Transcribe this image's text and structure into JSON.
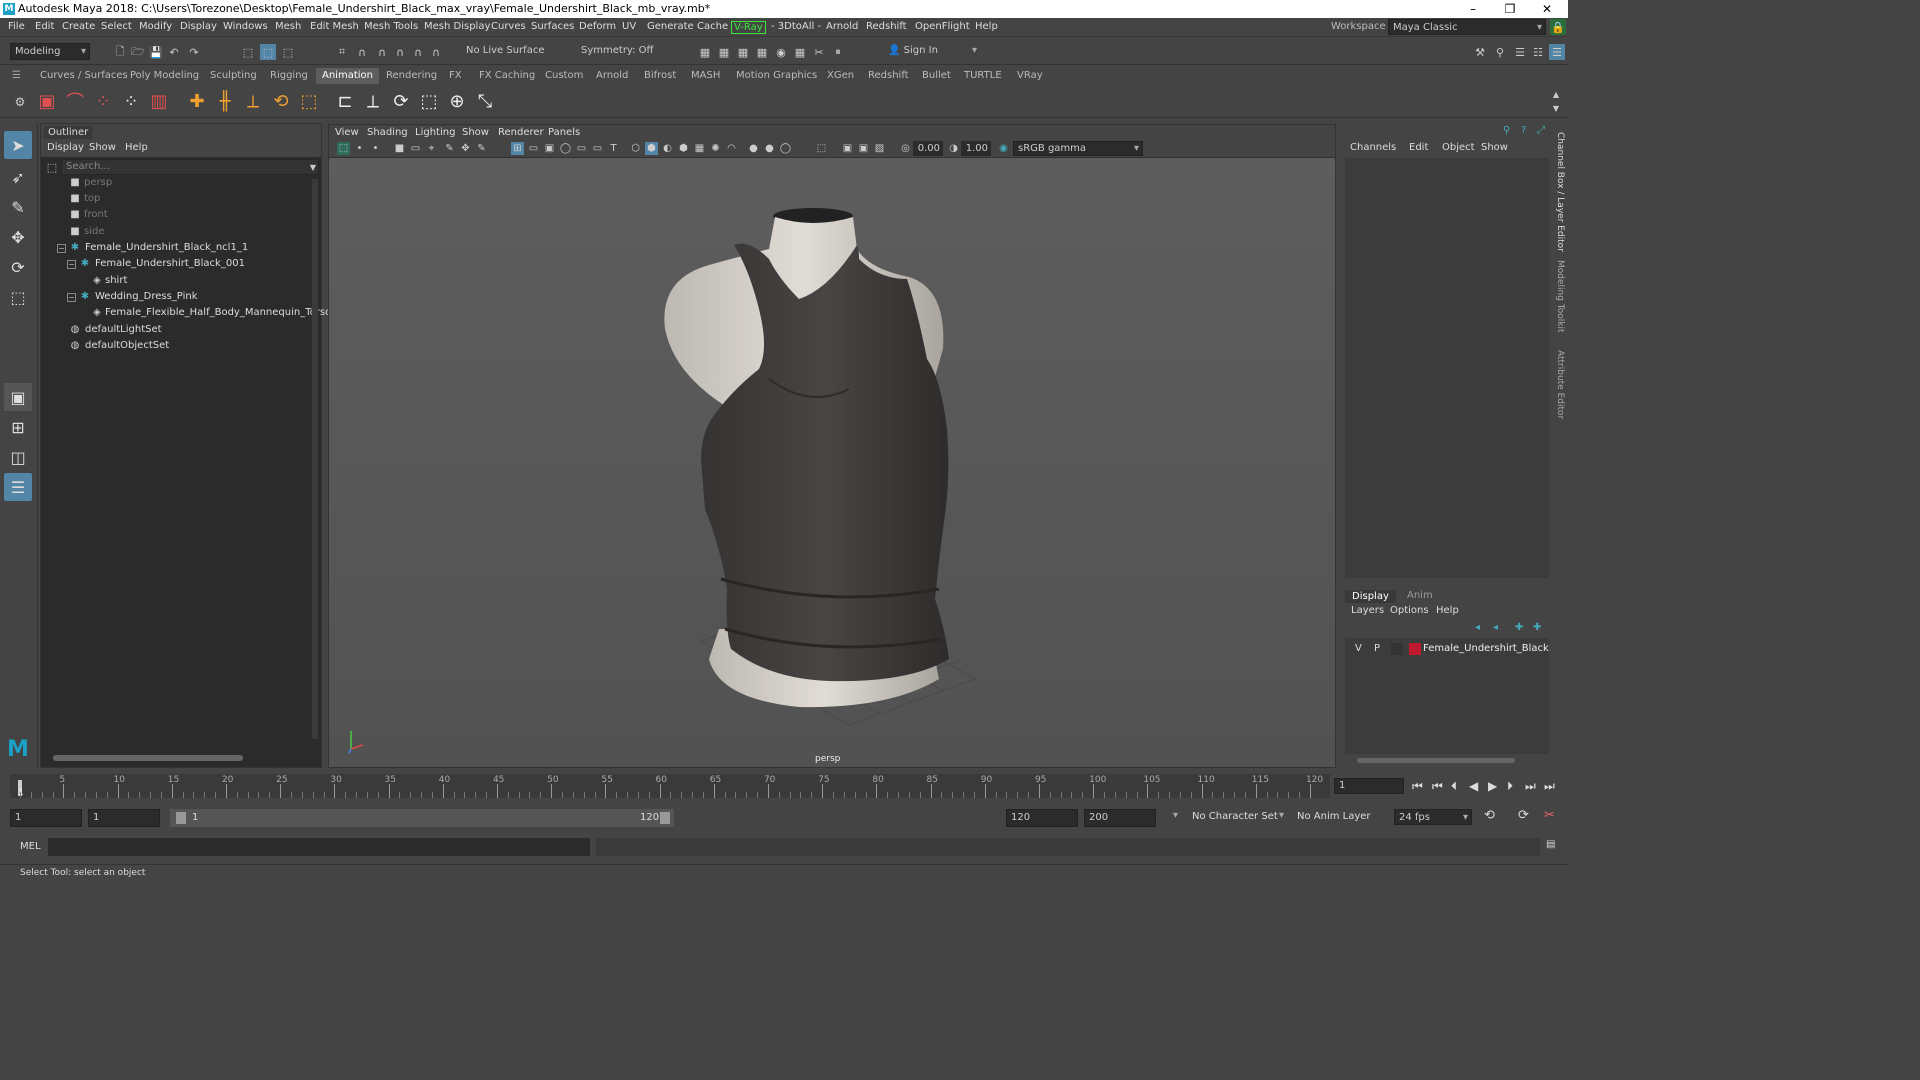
{
  "title": "Autodesk Maya 2018: C:\\Users\\Torezone\\Desktop\\Female_Undershirt_Black_max_vray\\Female_Undershirt_Black_mb_vray.mb*",
  "window_controls": {
    "minimize": "–",
    "restore": "❐",
    "close": "✕"
  },
  "menubar": [
    "File",
    "Edit",
    "Create",
    "Select",
    "Modify",
    "Display",
    "Windows",
    "Mesh",
    "Edit Mesh",
    "Mesh Tools",
    "Mesh Display",
    "Curves",
    "Surfaces",
    "Deform",
    "UV",
    "Generate",
    "Cache",
    "V-Ray",
    "- 3DtoAll -",
    "Arnold",
    "Redshift",
    "OpenFlight",
    "Help"
  ],
  "workspace": {
    "label": "Workspace :",
    "value": "Maya Classic"
  },
  "status": {
    "mode": "Modeling",
    "live_surface": "No Live Surface",
    "symmetry": "Symmetry: Off",
    "sign_in": "Sign In"
  },
  "shelf_tabs": [
    "Curves / Surfaces",
    "Poly Modeling",
    "Sculpting",
    "Rigging",
    "Animation",
    "Rendering",
    "FX",
    "FX Caching",
    "Custom",
    "Arnold",
    "Bifrost",
    "MASH",
    "Motion Graphics",
    "XGen",
    "Redshift",
    "Bullet",
    "TURTLE",
    "VRay"
  ],
  "shelf_active": "Animation",
  "outliner": {
    "title": "Outliner",
    "menu": [
      "Display",
      "Show",
      "Help"
    ],
    "search_placeholder": "Search...",
    "rows": [
      {
        "label": "persp",
        "icon": "camera-icon",
        "dim": true
      },
      {
        "label": "top",
        "icon": "camera-icon",
        "dim": true
      },
      {
        "label": "front",
        "icon": "camera-icon",
        "dim": true
      },
      {
        "label": "side",
        "icon": "camera-icon",
        "dim": true
      },
      {
        "label": "Female_Undershirt_Black_ncl1_1",
        "icon": "group-icon",
        "dim": false
      },
      {
        "label": "Female_Undershirt_Black_001",
        "icon": "group-icon",
        "dim": false
      },
      {
        "label": "shirt",
        "icon": "mesh-icon",
        "dim": false
      },
      {
        "label": "Wedding_Dress_Pink",
        "icon": "group-icon",
        "dim": false
      },
      {
        "label": "Female_Flexible_Half_Body_Mannequin_Torso_wi",
        "icon": "mesh-icon",
        "dim": false
      },
      {
        "label": "defaultLightSet",
        "icon": "set-icon",
        "dim": false
      },
      {
        "label": "defaultObjectSet",
        "icon": "set-icon",
        "dim": false
      }
    ]
  },
  "viewport": {
    "menu": [
      "View",
      "Shading",
      "Lighting",
      "Show",
      "Renderer",
      "Panels"
    ],
    "exposure": "0.00",
    "gamma": "1.00",
    "colorspace": "sRGB gamma",
    "camera_label": "persp"
  },
  "channelbox": {
    "menu": [
      "Channels",
      "Edit",
      "Object",
      "Show"
    ]
  },
  "layer_editor": {
    "tabs": [
      "Display",
      "Anim"
    ],
    "menu": [
      "Layers",
      "Options",
      "Help"
    ],
    "layer": {
      "v": "V",
      "p": "P",
      "name": "Female_Undershirt_Black",
      "color": "#c0182e"
    }
  },
  "side_tabs": [
    "Channel Box / Layer Editor",
    "Modeling Toolkit",
    "Attribute Editor"
  ],
  "timeline": {
    "ticks": [
      "5",
      "10",
      "15",
      "20",
      "25",
      "30",
      "35",
      "40",
      "45",
      "50",
      "55",
      "60",
      "65",
      "70",
      "75",
      "80",
      "85",
      "90",
      "95",
      "100",
      "105",
      "110",
      "115",
      "120"
    ],
    "current_frame": "1",
    "start_tick": "1"
  },
  "range": {
    "start": "1",
    "playback_start": "1",
    "slider_start": "1",
    "slider_end": "120",
    "playback_end": "120",
    "end": "200",
    "character_set": "No Character Set",
    "anim_layer": "No Anim Layer",
    "fps": "24 fps"
  },
  "cmdline": {
    "label": "MEL"
  },
  "help_line": "Select Tool: select an object",
  "colors": {
    "accent": "#5285a6",
    "active_tab": "#5d5d5d",
    "vray": "#39e639"
  }
}
